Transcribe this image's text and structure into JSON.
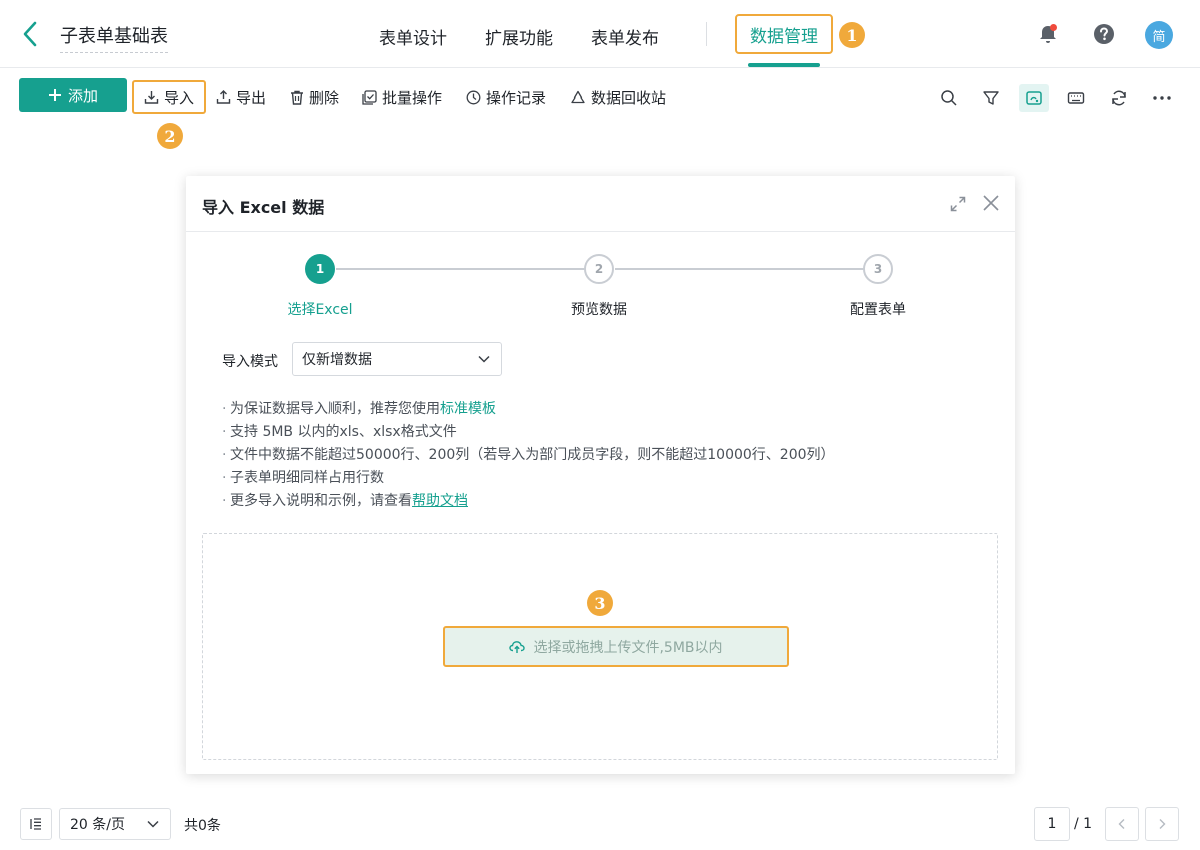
{
  "header": {
    "title": "子表单基础表",
    "tabs": [
      {
        "label": "表单设计"
      },
      {
        "label": "扩展功能"
      },
      {
        "label": "表单发布"
      },
      {
        "label": "数据管理"
      }
    ],
    "avatar_text": "简",
    "accent_color": "#16a08f",
    "highlight_color": "#f0a93b"
  },
  "badges": [
    "1",
    "2",
    "3"
  ],
  "toolbar": {
    "add_label": "添加",
    "import_label": "导入",
    "export_label": "导出",
    "delete_label": "删除",
    "batch_label": "批量操作",
    "log_label": "操作记录",
    "recycle_label": "数据回收站"
  },
  "dialog": {
    "title": "导入 Excel 数据",
    "steps": [
      {
        "number": "1",
        "label": "选择Excel"
      },
      {
        "number": "2",
        "label": "预览数据"
      },
      {
        "number": "3",
        "label": "配置表单"
      }
    ],
    "current_step": 1,
    "mode_label": "导入模式",
    "mode_value": "仅新增数据",
    "notes": {
      "n1_text": "为保证数据导入顺利，推荐您使用",
      "n1_link": "标准模板",
      "n2": "支持 5MB 以内的xls、xlsx格式文件",
      "n3": "文件中数据不能超过50000行、200列（若导入为部门成员字段，则不能超过10000行、200列）",
      "n4": "子表单明细同样占用行数",
      "n5_text": "更多导入说明和示例，请查看",
      "n5_link": "帮助文档"
    },
    "upload_label": "选择或拖拽上传文件,5MB以内"
  },
  "footer": {
    "page_size": "20 条/页",
    "total": "共0条",
    "current_page": "1",
    "page_of": "/ 1"
  }
}
